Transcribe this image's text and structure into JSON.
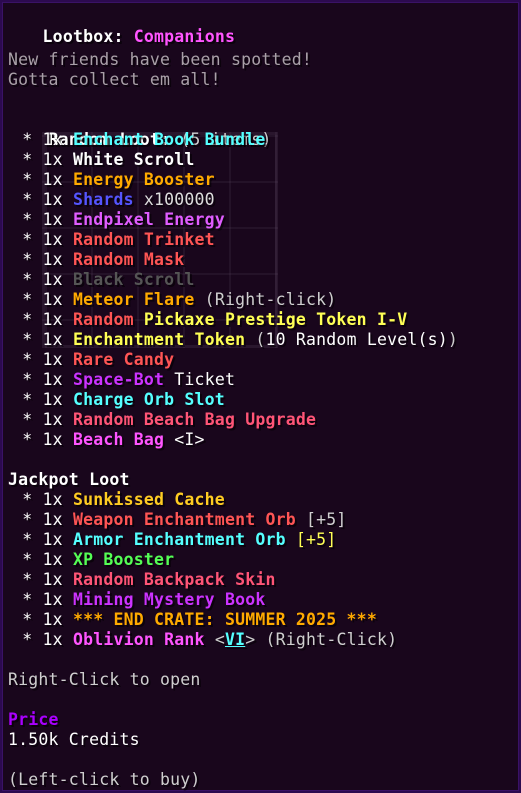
{
  "header": {
    "title_prefix": "Lootbox: ",
    "title_name": "Companions",
    "desc_line1": "New friends have been spotted!",
    "desc_line2": "Gotta collect em all!"
  },
  "random": {
    "heading": "Random Loot: ",
    "count": "(5 items)"
  },
  "random_items": [
    {
      "prefix": "  * 1x ",
      "name": "Enchant Book Bundle",
      "color": "#55ffff"
    },
    {
      "prefix": "  * 1x ",
      "name": "White Scroll",
      "color": "#ffffff"
    },
    {
      "prefix": "  * 1x ",
      "name": "Energy Booster",
      "color": "#ffaa00"
    },
    {
      "prefix": "  * 1x ",
      "name": "Shards",
      "color": "#5555ff",
      "suffix": " x100000",
      "suffix_color": "#dddddd"
    },
    {
      "prefix": "  * 1x ",
      "name": "Endpixel Energy",
      "color": "#e05dff"
    },
    {
      "prefix": "  * 1x ",
      "name": "Random Trinket",
      "color": "#ff5555"
    },
    {
      "prefix": "  * 1x ",
      "name": "Random Mask",
      "color": "#ff5555"
    },
    {
      "prefix": "  * 1x ",
      "name": "Black Scroll",
      "color": "#555555"
    },
    {
      "prefix": "  * 1x ",
      "name": "Meteor Flare",
      "color": "#ffaa00",
      "suffix": " (Right-click)",
      "suffix_color": "#cfcfcf"
    },
    {
      "prefix": "  * 1x ",
      "name": "Random Pickaxe Prestige Token I-V",
      "color": "#ff5555",
      "split_at": 7,
      "rest_color": "#ffff55"
    },
    {
      "prefix": "  * 1x ",
      "name": "Enchantment Token",
      "color": "#ffff55",
      "suffix_pre": " (",
      "suffix": "10 Random Level(s)",
      "suffix_post": ")",
      "suffix_color": "#ffffff"
    },
    {
      "prefix": "  * 1x ",
      "name": "Rare Candy",
      "color": "#ff5555"
    },
    {
      "prefix": "  * 1x ",
      "name": "Space-Bot",
      "color": "#cc33ff",
      "suffix": " Ticket",
      "suffix_color": "#ffffff",
      "plain_name": true
    },
    {
      "prefix": "  * 1x ",
      "name": "Charge Orb Slot",
      "color": "#55ffff"
    },
    {
      "prefix": "  * 1x ",
      "name": "Random Beach Bag Upgrade",
      "color": "#ff5577"
    },
    {
      "prefix": "  * 1x ",
      "name": "Beach Bag",
      "color": "#ff55ff",
      "suffix": " <I>",
      "suffix_color": "#ffffff"
    }
  ],
  "jackpot": {
    "heading": "Jackpot Loot"
  },
  "jackpot_items": [
    {
      "prefix": "  * 1x ",
      "name": "Sunkissed Cache",
      "color": "#ffcc22"
    },
    {
      "prefix": "  * 1x ",
      "name": "Weapon Enchantment Orb",
      "color": "#ff5555",
      "suffix": " [+5]",
      "suffix_color": "#cfcfcf"
    },
    {
      "prefix": "  * 1x ",
      "name": "Armor Enchantment Orb",
      "color": "#55ffff",
      "suffix": " [+5]",
      "suffix_color": "#ffff55"
    },
    {
      "prefix": "  * 1x ",
      "name": "XP Booster",
      "color": "#55ff55"
    },
    {
      "prefix": "  * 1x ",
      "name": "Random Backpack Skin",
      "color": "#ff5577"
    },
    {
      "prefix": "  * 1x ",
      "name": "Mining Mystery Book",
      "color": "#cc33ff"
    },
    {
      "prefix": "  * 1x ",
      "name": "*** END CRATE: SUMMER 2025 ***",
      "color": "#ffaa00",
      "plain_name": true
    },
    {
      "prefix": "  * 1x ",
      "name": "Oblivion Rank",
      "color": "#ff55ff",
      "suffix_pre": " <",
      "suffix": "VI",
      "suffix_post": "> (Right-Click)",
      "suffix_color": "#55ffff"
    }
  ],
  "footer": {
    "open_hint": "Right-Click to open",
    "price_label": "Price",
    "price_value": "1.50k Credits",
    "buy_hint": "(Left-click to buy)"
  },
  "colors": {
    "title_white": "#ffffff",
    "title_pink": "#ff55ff",
    "price_purple": "#aa00ff"
  }
}
